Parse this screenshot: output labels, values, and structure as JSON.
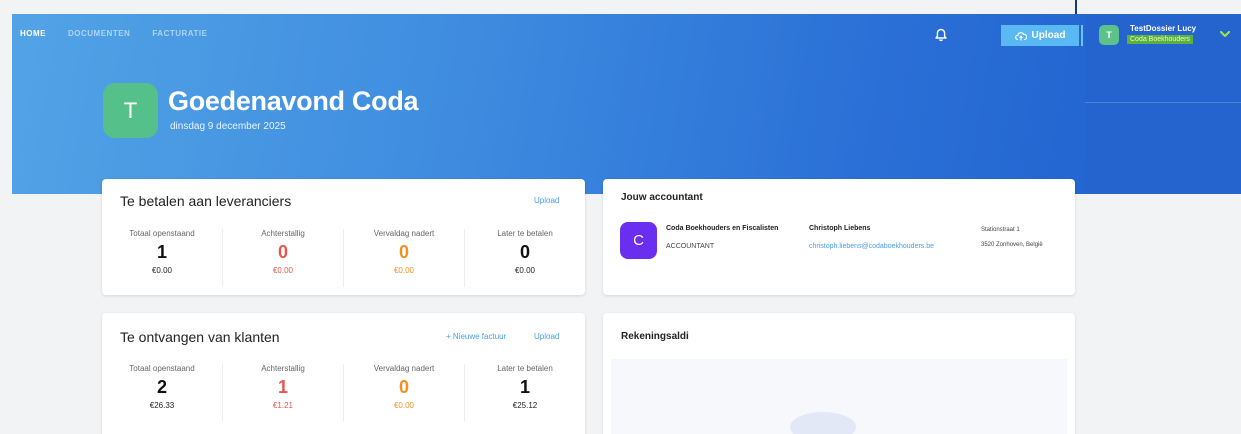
{
  "nav": {
    "items": [
      {
        "label": "HOME",
        "active": true
      },
      {
        "label": "DOCUMENTEN",
        "active": false
      },
      {
        "label": "FACTURATIE",
        "active": false
      }
    ]
  },
  "header": {
    "bell_icon": "bell-icon",
    "upload_label": "Upload",
    "upload_icon": "cloud-upload-icon",
    "user_initial": "T",
    "user_name": "TestDossier Lucy",
    "user_org": "Coda Boekhouders",
    "chevron_icon": "chevron-down-icon"
  },
  "hero": {
    "avatar_initial": "T",
    "greeting": "Goedenavond Coda",
    "date": "dinsdag 9 december 2025"
  },
  "payables": {
    "title": "Te betalen aan leveranciers",
    "upload_link": "Upload",
    "stats": [
      {
        "label": "Totaal openstaand",
        "count": "1",
        "amount": "€0.00",
        "tone": "default"
      },
      {
        "label": "Achterstallig",
        "count": "0",
        "amount": "€0.00",
        "tone": "red"
      },
      {
        "label": "Vervaldag nadert",
        "count": "0",
        "amount": "€0.00",
        "tone": "orange"
      },
      {
        "label": "Later te betalen",
        "count": "0",
        "amount": "€0.00",
        "tone": "default"
      }
    ]
  },
  "receivables": {
    "title": "Te ontvangen van klanten",
    "new_invoice_link": "+ Nieuwe factuur",
    "upload_link": "Upload",
    "stats": [
      {
        "label": "Totaal openstaand",
        "count": "2",
        "amount": "€26.33",
        "tone": "default"
      },
      {
        "label": "Achterstallig",
        "count": "1",
        "amount": "€1.21",
        "tone": "red"
      },
      {
        "label": "Vervaldag nadert",
        "count": "0",
        "amount": "€0.00",
        "tone": "orange"
      },
      {
        "label": "Later te betalen",
        "count": "1",
        "amount": "€25.12",
        "tone": "default"
      }
    ]
  },
  "accountant": {
    "title": "Jouw accountant",
    "initial": "C",
    "firm": "Coda Boekhouders en Fiscalisten",
    "role": "ACCOUNTANT",
    "contact_name": "Christoph Liebens",
    "email": "christoph.liebens@codaboekhouders.be",
    "address_line1": "Stationstraat 1",
    "address_line2": "3520 Zonhoven, België"
  },
  "balances": {
    "title": "Rekeningsaldi"
  },
  "colors": {
    "accent": "#4a9ee8",
    "overdue": "#e5584f",
    "due_soon": "#f29022",
    "avatar_green": "#56c08b",
    "accountant_purple": "#6a2ef0"
  }
}
